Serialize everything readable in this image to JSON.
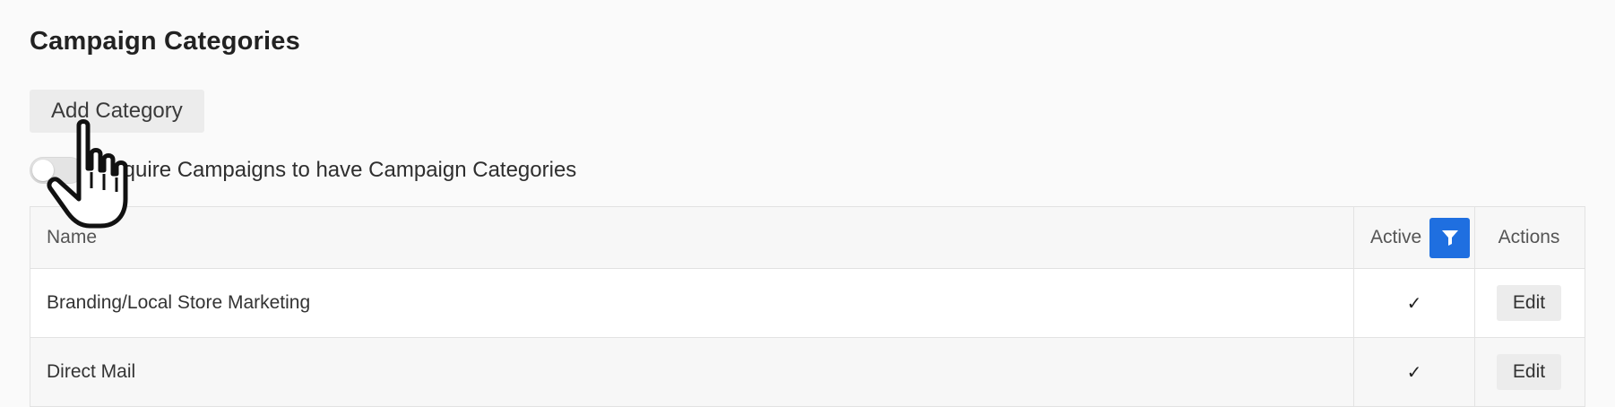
{
  "page": {
    "title": "Campaign Categories"
  },
  "toolbar": {
    "add_label": "Add Category"
  },
  "require_toggle": {
    "label": "Require Campaigns to have Campaign Categories",
    "enabled": false
  },
  "table": {
    "headers": {
      "name": "Name",
      "active": "Active",
      "actions": "Actions"
    },
    "rows": [
      {
        "name": "Branding/Local Store Marketing",
        "active": "✓",
        "action": "Edit"
      },
      {
        "name": "Direct Mail",
        "active": "✓",
        "action": "Edit"
      }
    ]
  },
  "icons": {
    "filter": "filter-icon",
    "cursor": "hand-pointer-cursor"
  },
  "colors": {
    "accent": "#1f6fe0",
    "background": "#fafafa"
  }
}
